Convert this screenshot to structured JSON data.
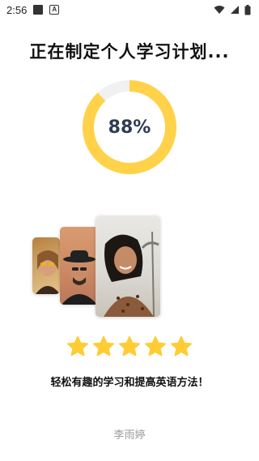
{
  "status_bar": {
    "time": "2:56",
    "icons": [
      "notification-square-icon",
      "a-box-icon",
      "wifi-icon",
      "cellular-signal-icon",
      "battery-icon"
    ]
  },
  "main": {
    "title": "正在制定个人学习计划...",
    "progress": {
      "label": "88%",
      "value": 0.88,
      "ring_color": "#ffd24a",
      "track_color": "#f1f1f1",
      "text_color": "#2f3b52"
    },
    "photos": [
      "portrait-photo-sunglasses",
      "portrait-photo-hat",
      "portrait-photo-curly-hair"
    ],
    "rating": {
      "stars": 5,
      "max": 5,
      "star_color": "#ffcc33"
    },
    "tagline": "轻松有趣的学习和提高英语方法！",
    "user_name": "李雨婷"
  }
}
